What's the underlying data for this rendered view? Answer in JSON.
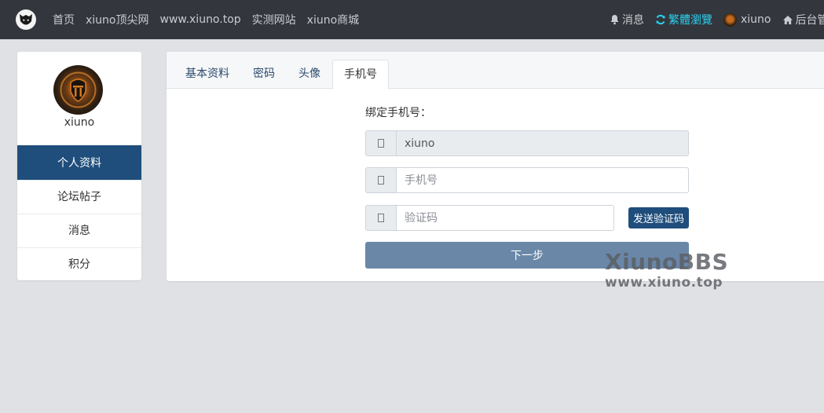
{
  "navbar": {
    "links": [
      "首页",
      "xiuno顶尖网",
      "www.xiuno.top",
      "实测网站",
      "xiuno商城"
    ],
    "messages_label": "消息",
    "traditional_label": "繁體瀏覽",
    "username": "xiuno",
    "admin_label": "后台管"
  },
  "sidebar": {
    "username": "xiuno",
    "items": [
      {
        "label": "个人资料",
        "active": true
      },
      {
        "label": "论坛帖子",
        "active": false
      },
      {
        "label": "消息",
        "active": false
      },
      {
        "label": "积分",
        "active": false
      }
    ]
  },
  "tabs": [
    {
      "label": "基本资料",
      "active": false
    },
    {
      "label": "密码",
      "active": false
    },
    {
      "label": "头像",
      "active": false
    },
    {
      "label": "手机号",
      "active": true
    }
  ],
  "form": {
    "title": "绑定手机号：",
    "username_value": "xiuno",
    "phone_placeholder": "手机号",
    "code_placeholder": "验证码",
    "send_code_label": "发送验证码",
    "next_label": "下一步"
  },
  "watermark": {
    "title": "XiunoBBS",
    "url": "www.xiuno.top"
  },
  "colors": {
    "navbar_bg": "#33373d",
    "accent": "#1f4e7c",
    "next_button": "#6a87a8",
    "traditional_link": "#2ad0f0",
    "page_bg": "#dfe1e5"
  }
}
